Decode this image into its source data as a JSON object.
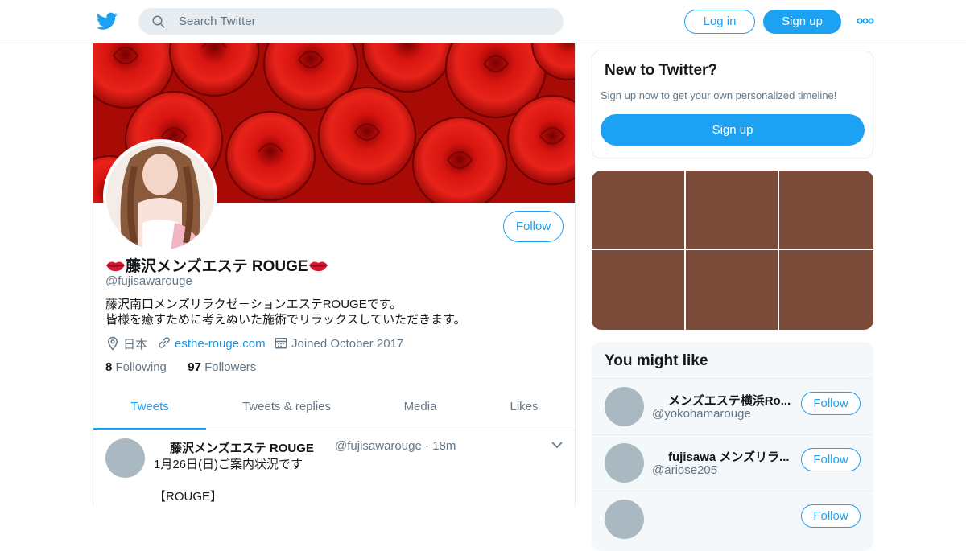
{
  "header": {
    "search_placeholder": "Search Twitter",
    "login_label": "Log in",
    "signup_label": "Sign up"
  },
  "profile": {
    "display_name": "藤沢メンズエステ ROUGE",
    "handle": "@fujisawarouge",
    "follow_label": "Follow",
    "bio_line1": "藤沢南口メンズリラクゼ－ションエステROUGEです。",
    "bio_line2": "皆様を癒すために考えぬいた施術でリラックスしていただきます。",
    "location": "日本",
    "website": "esthe-rouge.com",
    "joined": "Joined October 2017",
    "following_count": "8",
    "following_label": "Following",
    "followers_count": "97",
    "followers_label": "Followers"
  },
  "tabs": [
    {
      "label": "Tweets",
      "active": true
    },
    {
      "label": "Tweets & replies",
      "active": false
    },
    {
      "label": "Media",
      "active": false
    },
    {
      "label": "Likes",
      "active": false
    }
  ],
  "tweet": {
    "name": "藤沢メンズエステ ROUGE",
    "handle": "@fujisawarouge",
    "dot": "·",
    "time": "18m",
    "text": "1月26日(日)ご案内状況です\n\n【ROUGE】"
  },
  "new_card": {
    "title": "New to Twitter?",
    "subtitle": "Sign up now to get your own personalized timeline!",
    "signup_label": "Sign up"
  },
  "you_might_like": {
    "title": "You might like",
    "items": [
      {
        "name": "メンズエステ横浜Ro...",
        "handle": "@yokohamarouge",
        "follow_label": "Follow"
      },
      {
        "name": "fujisawa メンズリラ...",
        "handle": "@ariose205",
        "follow_label": "Follow"
      },
      {
        "name": "",
        "handle": "",
        "follow_label": "Follow"
      }
    ]
  },
  "colors": {
    "accent": "#1da1f2",
    "media_tile": "#7b4a39",
    "banner_red": "#c0100c"
  },
  "icons": [
    "twitter-bird-icon",
    "search-icon",
    "more-dots-icon",
    "location-pin-icon",
    "link-icon",
    "calendar-icon",
    "chevron-down-icon",
    "kiss-lips-icon"
  ]
}
